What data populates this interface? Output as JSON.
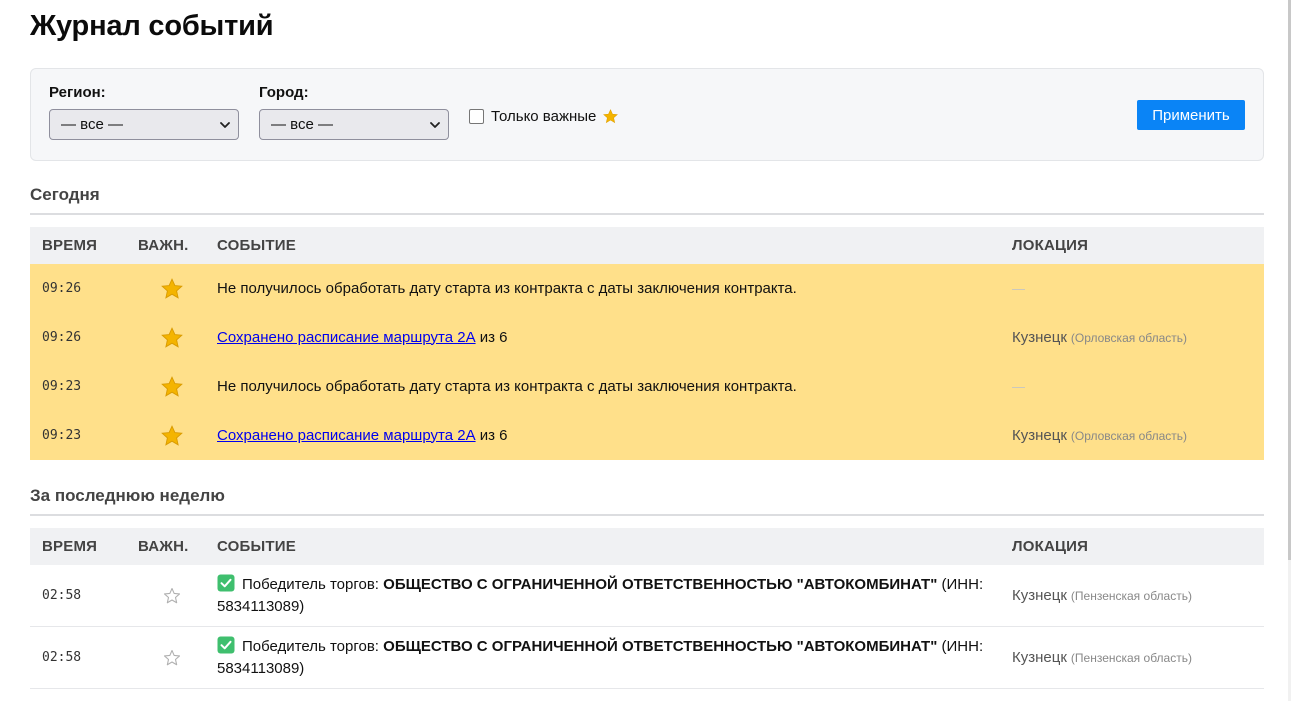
{
  "page": {
    "title": "Журнал событий"
  },
  "filters": {
    "region_label": "Регион:",
    "region_value": "— все —",
    "city_label": "Город:",
    "city_value": "— все —",
    "important_only_label": "Только важные",
    "important_only_checked": false,
    "apply_label": "Применить"
  },
  "columns": {
    "time": "ВРЕМЯ",
    "importance": "ВАЖН.",
    "event": "СОБЫТИЕ",
    "location": "ЛОКАЦИЯ"
  },
  "colors": {
    "important_row": "#ffe08a",
    "apply_button": "#0a84f6",
    "star": "#f4b400",
    "check_badge": "#3fbf6e"
  },
  "sections": [
    {
      "title": "Сегодня",
      "rows": [
        {
          "time": "09:26",
          "important": true,
          "event_text": "Не получилось обработать дату старта из контракта с даты заключения контракта.",
          "location_dash": "—"
        },
        {
          "time": "09:26",
          "important": true,
          "event_link": "Сохранено расписание маршрута 2А",
          "event_suffix": " из 6",
          "location_city": "Кузнецк",
          "location_region": "(Орловская область)"
        },
        {
          "time": "09:23",
          "important": true,
          "event_text": "Не получилось обработать дату старта из контракта с даты заключения контракта.",
          "location_dash": "—"
        },
        {
          "time": "09:23",
          "important": true,
          "event_link": "Сохранено расписание маршрута 2А",
          "event_suffix": " из 6",
          "location_city": "Кузнецк",
          "location_region": "(Орловская область)"
        }
      ]
    },
    {
      "title": "За последнюю неделю",
      "rows": [
        {
          "time": "02:58",
          "important": false,
          "event_prefix": "Победитель торгов: ",
          "event_bold": "ОБЩЕСТВО С ОГРАНИЧЕННОЙ ОТВЕТСТВЕННОСТЬЮ \"АВТОКОМБИНАТ\"",
          "event_suffix": " (ИНН: 5834113089)",
          "location_city": "Кузнецк",
          "location_region": "(Пензенская область)"
        },
        {
          "time": "02:58",
          "important": false,
          "event_prefix": "Победитель торгов: ",
          "event_bold": "ОБЩЕСТВО С ОГРАНИЧЕННОЙ ОТВЕТСТВЕННОСТЬЮ \"АВТОКОМБИНАТ\"",
          "event_suffix": " (ИНН: 5834113089)",
          "location_city": "Кузнецк",
          "location_region": "(Пензенская область)"
        }
      ]
    }
  ]
}
